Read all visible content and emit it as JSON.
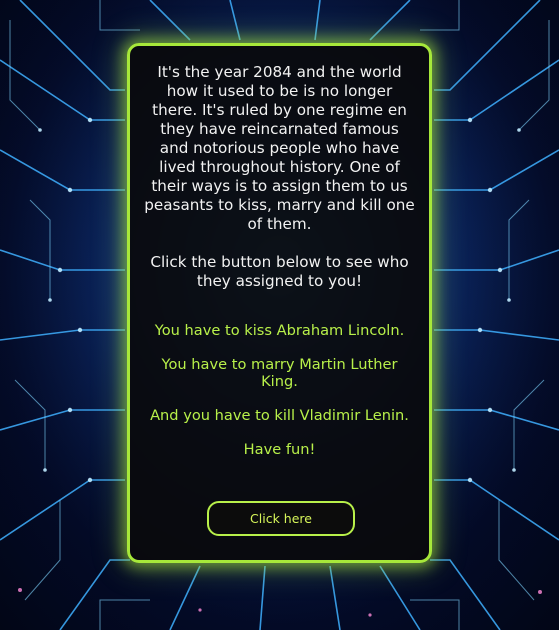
{
  "story": {
    "intro": "It's the year 2084 and the world how it used to be is no longer there. It's ruled by one regime en they have reincarnated famous and notorious people who have lived throughout history. One of their ways is to assign them to us peasants to kiss, marry and kill one of them.",
    "prompt": "Click the button below to see who they assigned to you!"
  },
  "results": {
    "kiss": "You have to kiss Abraham Lincoln.",
    "marry": "You have to marry Martin Luther King.",
    "kill": "And you have to kill Vladimir Lenin.",
    "closing": "Have fun!"
  },
  "button": {
    "label": "Click here"
  },
  "colors": {
    "accent": "#a7e83a",
    "result_text": "#b8f04a",
    "card_bg": "#0a0a0c",
    "background": "#071a48",
    "circuit": "#3fb0ff"
  },
  "background": {
    "image": "blue-circuit-board-tunnel"
  }
}
